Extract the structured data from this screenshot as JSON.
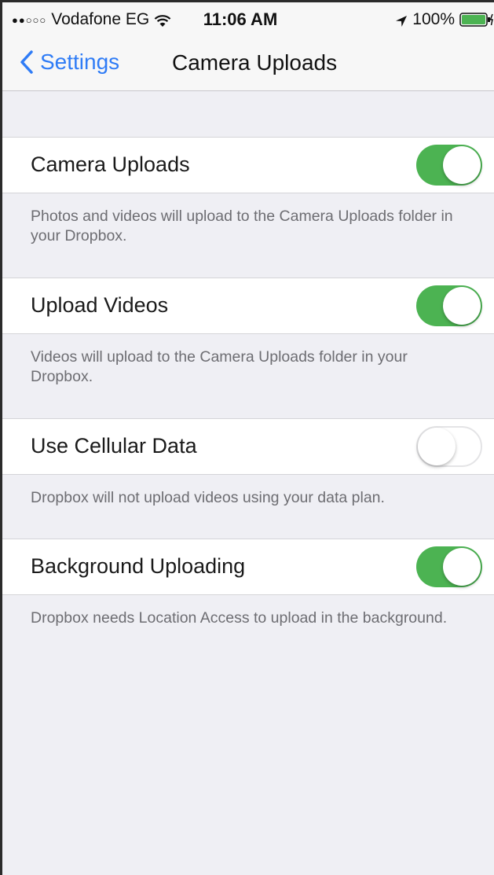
{
  "status_bar": {
    "signal": "●●○○○",
    "carrier": "Vodafone EG",
    "wifi_icon": "wifi-icon",
    "time": "11:06 AM",
    "location_icon": "location-arrow-icon",
    "battery": "100%",
    "battery_icon": "battery-charging-icon"
  },
  "nav": {
    "back_icon": "chevron-left-icon",
    "back_label": "Settings",
    "title": "Camera Uploads"
  },
  "settings": [
    {
      "label": "Camera Uploads",
      "enabled": true,
      "description": "Photos and videos will upload to the Camera Uploads folder in your Dropbox."
    },
    {
      "label": "Upload Videos",
      "enabled": true,
      "description": "Videos will upload to the Camera Uploads folder in your Dropbox."
    },
    {
      "label": "Use Cellular Data",
      "enabled": false,
      "description": "Dropbox will not upload videos using your data plan."
    },
    {
      "label": "Background Uploading",
      "enabled": true,
      "description": "Dropbox needs Location Access to upload in the background."
    }
  ],
  "colors": {
    "accent": "#2f7cf6",
    "toggle_on": "#4cb352",
    "background": "#efeff4",
    "footer_text": "#6d6d72"
  }
}
